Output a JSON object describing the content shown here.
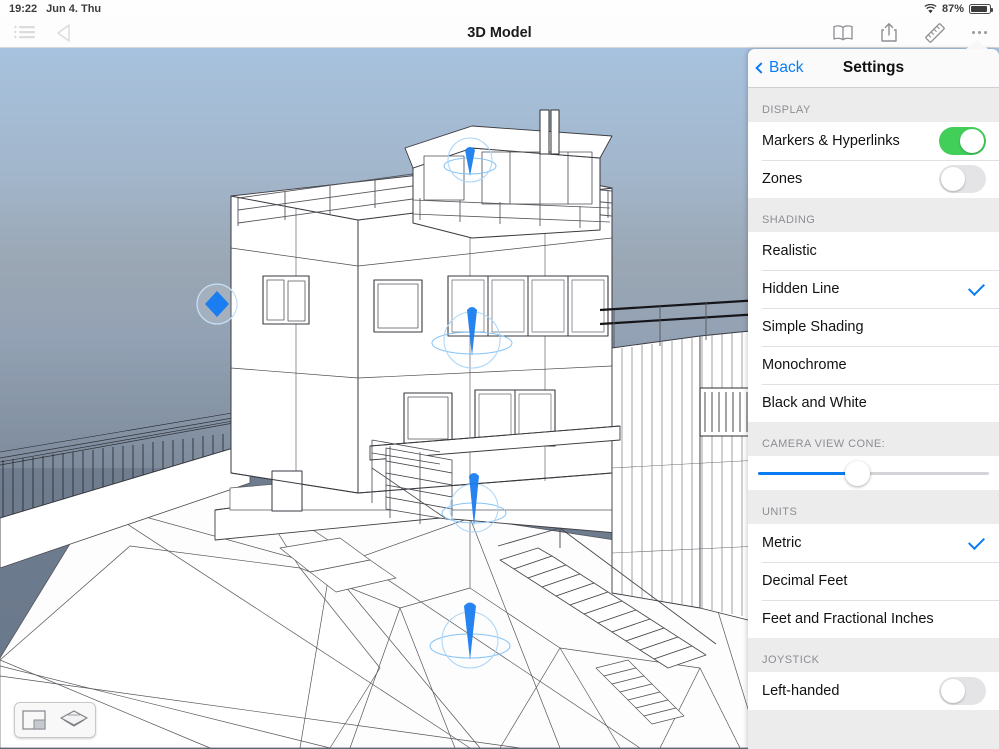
{
  "statusbar": {
    "time": "19:22",
    "date": "Jun 4. Thu",
    "battery_percent": "87%",
    "wifi_icon": "wifi-icon",
    "battery_icon": "battery-icon"
  },
  "toolbar": {
    "title": "3D Model",
    "menu_icon": "list-menu-icon",
    "back_icon": "back-triangle-icon",
    "book_icon": "book-icon",
    "share_icon": "share-icon",
    "ruler_icon": "ruler-icon",
    "more_icon": "more-dots-icon"
  },
  "viewport": {
    "marker_icon": "blue-diamond-marker",
    "pin_icon": "blue-pin-marker",
    "view_toggle": {
      "layout_icon": "2d-layout-icon",
      "model_icon": "3d-model-icon"
    },
    "walk_button_icon": "walking-person-icon",
    "sky_top_color": "#a8c0dc",
    "sky_horizon_color": "#9aa3ae",
    "ground_color": "#ffffff",
    "line_color": "#3c3c3c",
    "marker_color": "#1a7ef0"
  },
  "settings": {
    "back_label": "Back",
    "title": "Settings",
    "back_chevron_icon": "chevron-left-icon",
    "accent_color": "#0a7cf3",
    "switch_on_color": "#41cf5a",
    "sections": [
      {
        "header": "DISPLAY",
        "type": "switches",
        "rows": [
          {
            "label": "Markers & Hyperlinks",
            "state": "on"
          },
          {
            "label": "Zones",
            "state": "off"
          }
        ]
      },
      {
        "header": "SHADING",
        "type": "options",
        "rows": [
          {
            "label": "Realistic",
            "selected": false
          },
          {
            "label": "Hidden Line",
            "selected": true
          },
          {
            "label": "Simple Shading",
            "selected": false
          },
          {
            "label": "Monochrome",
            "selected": false
          },
          {
            "label": "Black and White",
            "selected": false
          }
        ]
      },
      {
        "header": "CAMERA VIEW CONE:",
        "type": "slider",
        "value": 43
      },
      {
        "header": "UNITS",
        "type": "options",
        "rows": [
          {
            "label": "Metric",
            "selected": true
          },
          {
            "label": "Decimal Feet",
            "selected": false
          },
          {
            "label": "Feet and Fractional Inches",
            "selected": false
          }
        ]
      },
      {
        "header": "JOYSTICK",
        "type": "switches",
        "rows": [
          {
            "label": "Left-handed",
            "state": "off"
          }
        ]
      }
    ]
  }
}
